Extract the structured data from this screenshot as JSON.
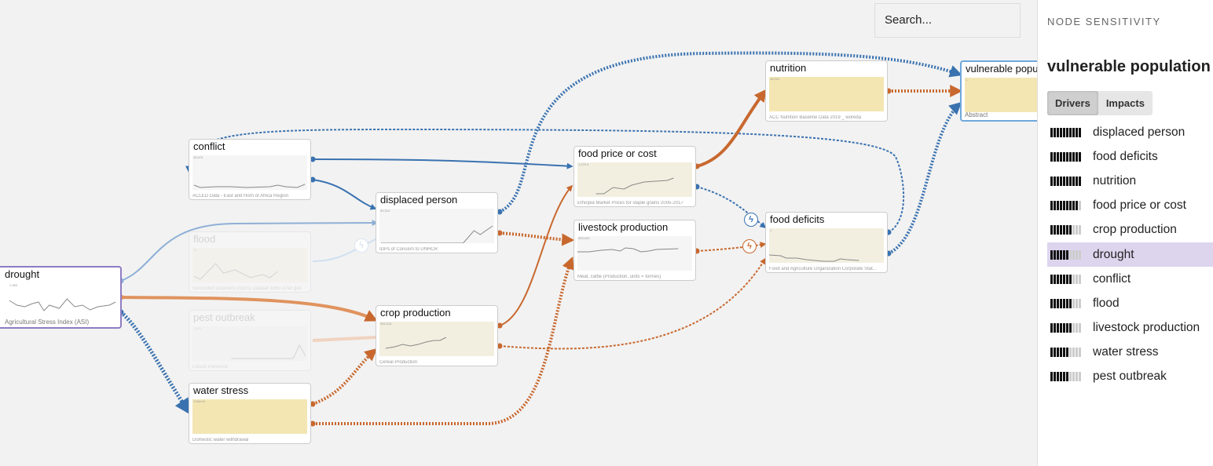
{
  "search": {
    "placeholder": "Search..."
  },
  "colors": {
    "positive": "#3a72b0",
    "negative": "#c8682e",
    "selected": "#8e7cc3",
    "target": "#6fa8dc"
  },
  "nodes": {
    "drought": {
      "title": "drought",
      "max": "1.983",
      "source": "Agricultural Stress Index (ASI)"
    },
    "conflict": {
      "title": "conflict",
      "max": "33,074",
      "source": "ACLED Data - East and Horn of Africa Region"
    },
    "flood": {
      "title": "flood",
      "max": "15",
      "source": "Geocoded Disasters (GDIS) Dataset 1960-2018 geo"
    },
    "pest": {
      "title": "pest outbreak",
      "max": "1,000",
      "source": "Locust Presence"
    },
    "water": {
      "title": "water stress",
      "max": "1.54e+8",
      "source": "Domestic water withdrawal"
    },
    "displaced": {
      "title": "displaced person",
      "max": "30,314",
      "source": "IDPs of Concern to UNHCR"
    },
    "crop": {
      "title": "crop production",
      "max": "945,316",
      "source": "Cereal Production"
    },
    "foodprice": {
      "title": "food price or cost",
      "max": "1,475.4",
      "source": "Ethiopia Market Prices for staple grains 2005-2017"
    },
    "livestock": {
      "title": "livestock production",
      "max": "655,000",
      "source": "Meat, cattle (Production, units = tonnes)"
    },
    "nutrition": {
      "title": "nutrition",
      "max": "16,001",
      "source": "ACC Nutrition Baseline Data 2019 _ woreda"
    },
    "deficits": {
      "title": "food deficits",
      "max": "1",
      "source": "Food and Agriculture Organization Corporate Stat..."
    },
    "vulnerable": {
      "title": "vulnerable population",
      "max": "1",
      "source": "Abstract"
    }
  },
  "sidebar": {
    "heading": "NODE SENSITIVITY",
    "node": "vulnerable population",
    "tabs": [
      {
        "label": "Drivers",
        "active": true
      },
      {
        "label": "Impacts",
        "active": false
      }
    ],
    "items": [
      {
        "label": "displaced person",
        "score": 10
      },
      {
        "label": "food deficits",
        "score": 10
      },
      {
        "label": "nutrition",
        "score": 10
      },
      {
        "label": "food price or cost",
        "score": 9
      },
      {
        "label": "crop production",
        "score": 7
      },
      {
        "label": "drought",
        "score": 6,
        "highlighted": true
      },
      {
        "label": "conflict",
        "score": 7
      },
      {
        "label": "flood",
        "score": 7
      },
      {
        "label": "livestock production",
        "score": 7
      },
      {
        "label": "water stress",
        "score": 6
      },
      {
        "label": "pest outbreak",
        "score": 6
      }
    ]
  }
}
